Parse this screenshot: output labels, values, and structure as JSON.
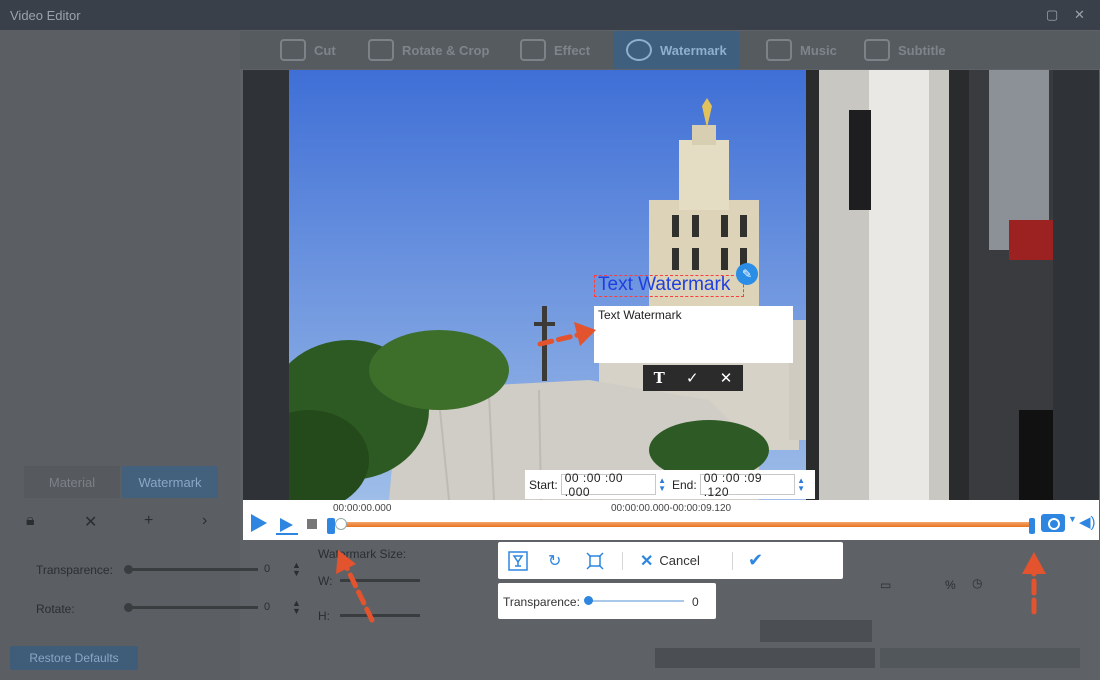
{
  "window": {
    "title": "Video Editor"
  },
  "tabs": [
    {
      "label": "Cut",
      "icon": "scissors-icon",
      "active": false
    },
    {
      "label": "Rotate & Crop",
      "icon": "crop-icon",
      "active": false
    },
    {
      "label": "Effect",
      "icon": "effect-icon",
      "active": false
    },
    {
      "label": "Watermark",
      "icon": "film-reel-icon",
      "active": true
    },
    {
      "label": "Music",
      "icon": "music-note-icon",
      "active": false
    },
    {
      "label": "Subtitle",
      "icon": "subtitle-icon",
      "active": false
    }
  ],
  "left_panel": {
    "subtabs": [
      "Material",
      "Watermark"
    ],
    "active_subtab": "Watermark",
    "transparence_label": "Transparence:",
    "transparence_value": "0",
    "rotate_label": "Rotate:",
    "rotate_value": "0",
    "watermark_size_label": "Watermark Size:",
    "width_label": "W:",
    "height_label": "H:",
    "restore_label": "Restore Defaults"
  },
  "watermark": {
    "overlay_text": "Text Watermark",
    "editor_value": "Text Watermark",
    "text_color": "#1f3fe0"
  },
  "time_range": {
    "start_label": "Start:",
    "start_value": "00 :00 :00 .000",
    "end_label": "End:",
    "end_value": "00 :00 :09 .120"
  },
  "timeline": {
    "current_time": "00:00:00.000",
    "range": "00:00:00.000-00:00:09.120",
    "progress": 0
  },
  "actions": {
    "cancel_label": "Cancel"
  },
  "transparence_popup": {
    "label": "Transparence:",
    "value": "0",
    "level": 0
  },
  "colors": {
    "accent": "#2e86e0",
    "track": "#e8731f",
    "arrow": "#e2532e"
  }
}
